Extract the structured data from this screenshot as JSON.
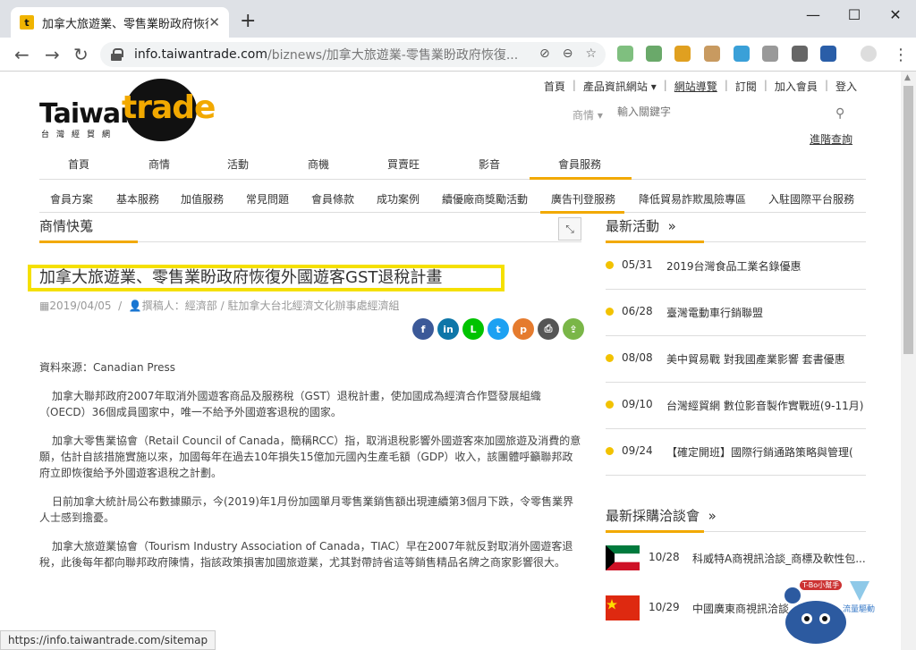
{
  "browser": {
    "tab_title": "加拿大旅遊業、零售業盼政府恢復外國...",
    "favicon_glyph": "t",
    "new_tab": "+",
    "url_host": "info.taiwantrade.com",
    "url_path": "/biznews/加拿大旅遊業-零售業盼政府恢復...",
    "status_url": "https://info.taiwantrade.com/sitemap"
  },
  "site": {
    "logo_taiwan": "Taiwan",
    "logo_trade": "trade",
    "logo_sub": "台灣經貿網",
    "toplinks": [
      "首頁",
      "產品資訊網站",
      "網站導覽",
      "訂閱",
      "加入會員",
      "登入"
    ],
    "search_type": "商情",
    "search_placeholder": "輸入關鍵字",
    "advanced_search": "進階查詢",
    "mainnav": [
      "首頁",
      "商情",
      "活動",
      "商機",
      "買賣旺",
      "影音",
      "會員服務"
    ],
    "subnav": [
      "會員方案",
      "基本服務",
      "加值服務",
      "常見問題",
      "會員條款",
      "成功案例",
      "續優廠商獎勵活動",
      "廣告刊登服務",
      "降低貿易詐欺風險專區",
      "入駐國際平台服務"
    ]
  },
  "content": {
    "section_title": "商情快蒐",
    "headline": "加拿大旅遊業、零售業盼政府恢復外國遊客GST退稅計畫",
    "date": "2019/04/05",
    "author": "撰稿人：經濟部 / 駐加拿大台北經濟文化辦事處經濟組",
    "paragraphs": [
      "資料來源：Canadian Press",
      "加拿大聯邦政府2007年取消外國遊客商品及服務稅（GST）退稅計畫，使加國成為經濟合作暨發展組織（OECD）36個成員國家中，唯一不給予外國遊客退稅的國家。",
      "加拿大零售業協會（Retail Council of Canada，簡稱RCC）指，取消退稅影響外國遊客來加國旅遊及消費的意願，估計自該措施實施以來，加國每年在過去10年損失15億加元國內生產毛額（GDP）收入，該團體呼籲聯邦政府立即恢復給予外國遊客退稅之計劃。",
      "日前加拿大統計局公布數據顯示，今(2019)年1月份加國單月零售業銷售額出現連續第3個月下跌，令零售業界人士感到擔憂。",
      "加拿大旅遊業協會（Tourism Industry Association of Canada，TIAC）早在2007年就反對取消外國遊客退稅，此後每年都向聯邦政府陳情，指該政策損害加國旅遊業，尤其對帶詩省這等銷售精品名牌之商家影響很大。"
    ],
    "socials": [
      {
        "name": "facebook-icon",
        "glyph": "f",
        "color": "#3b5998"
      },
      {
        "name": "linkedin-icon",
        "glyph": "in",
        "color": "#0e76a8"
      },
      {
        "name": "line-icon",
        "glyph": "L",
        "color": "#00c300"
      },
      {
        "name": "twitter-icon",
        "glyph": "t",
        "color": "#1da1f2"
      },
      {
        "name": "plurk-icon",
        "glyph": "p",
        "color": "#e57b2e"
      },
      {
        "name": "print-icon",
        "glyph": "⎙",
        "color": "#555555"
      },
      {
        "name": "green-share-icon",
        "glyph": "⇪",
        "color": "#7ab648"
      }
    ]
  },
  "sidebar": {
    "events_title": "最新活動",
    "events": [
      {
        "date": "05/31",
        "text": "2019台灣食品工業名錄優惠"
      },
      {
        "date": "06/28",
        "text": "臺灣電動車行銷聯盟"
      },
      {
        "date": "08/08",
        "text": "美中貿易戰 對我國產業影響 套書優惠"
      },
      {
        "date": "09/10",
        "text": "台灣經貿網 數位影音製作實戰班(9-11月)"
      },
      {
        "date": "09/24",
        "text": "【確定開班】國際行銷通路策略與管理("
      }
    ],
    "fairs_title": "最新採購洽談會",
    "fairs": [
      {
        "date": "10/28",
        "text": "科威特A商視訊洽談_商標及軟性包..."
      },
      {
        "date": "10/29",
        "text": "中國廣東商視訊洽談"
      }
    ],
    "more_glyph": "»"
  },
  "mascot": {
    "badge": "T-Bo小幫手",
    "label": "流量驅動"
  }
}
